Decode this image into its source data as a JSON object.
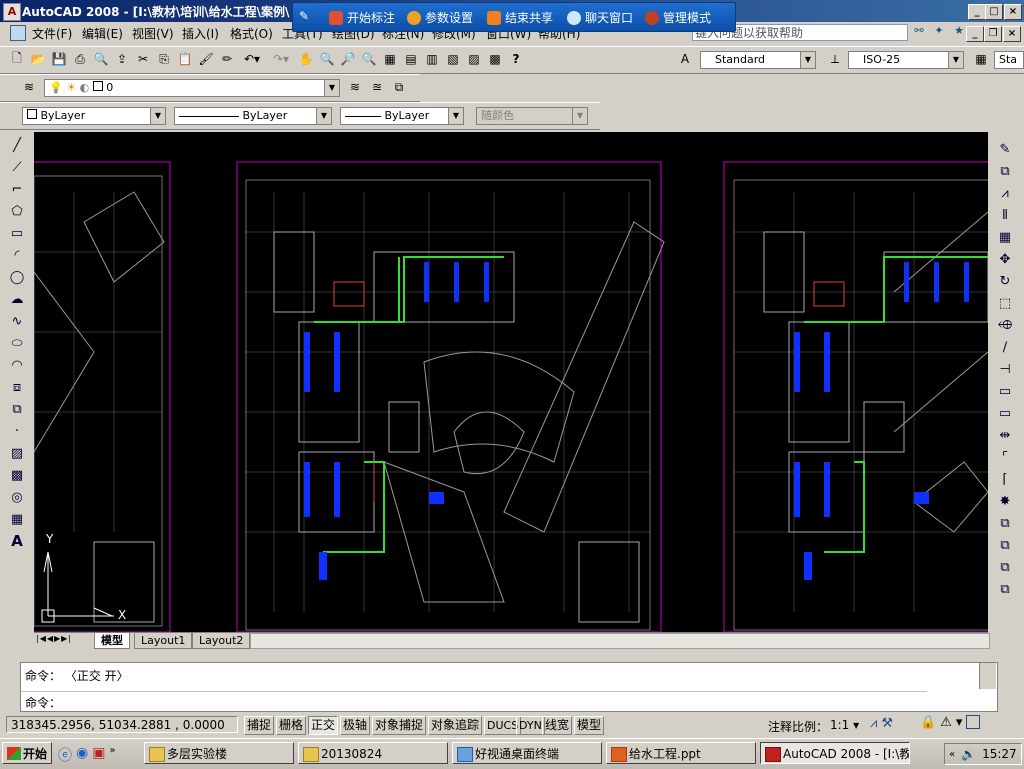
{
  "window": {
    "title": "AutoCAD 2008 - [I:\\教材\\培训\\给水工程\\案例\\",
    "buttons": [
      "_",
      "□",
      "×"
    ]
  },
  "sharebar": {
    "items": [
      {
        "label": "开始标注",
        "color": "#e05030"
      },
      {
        "label": "参数设置",
        "color": "#f0a020"
      },
      {
        "label": "结束共享",
        "color": "#f08020"
      },
      {
        "label": "聊天窗口",
        "color": "#d0e8ff"
      },
      {
        "label": "管理模式",
        "color": "#c04020"
      }
    ]
  },
  "menu": {
    "items": [
      "文件(F)",
      "编辑(E)",
      "视图(V)",
      "插入(I)",
      "格式(O)",
      "工具(T)",
      "绘图(D)",
      "标注(N)",
      "修改(M)",
      "窗口(W)",
      "帮助(H)"
    ],
    "help_placeholder": "键入问题以获取帮助"
  },
  "styles": {
    "text_style": "Standard",
    "dim_style": "ISO-25",
    "table_style": "Sta"
  },
  "layers": {
    "current": "0"
  },
  "properties": {
    "color": "ByLayer",
    "linetype": "ByLayer",
    "lineweight": "ByLayer",
    "plotstyle": "随颜色"
  },
  "tabs": [
    "模型",
    "Layout1",
    "Layout2"
  ],
  "ucs": {
    "y": "Y",
    "x": "X"
  },
  "command": {
    "history": "命令：  〈正交 开〉",
    "prompt": "命令："
  },
  "status": {
    "coords": "318345.2956, 51034.2881 , 0.0000",
    "toggles": [
      {
        "label": "捕捉",
        "on": false
      },
      {
        "label": "栅格",
        "on": false
      },
      {
        "label": "正交",
        "on": true
      },
      {
        "label": "极轴",
        "on": false
      },
      {
        "label": "对象捕捉",
        "on": false
      },
      {
        "label": "对象追踪",
        "on": false
      },
      {
        "label": "DUCS",
        "on": false
      },
      {
        "label": "DYN",
        "on": false
      },
      {
        "label": "线宽",
        "on": false
      },
      {
        "label": "模型",
        "on": false
      }
    ],
    "scale_label": "注释比例：",
    "scale_value": "1:1"
  },
  "taskbar": {
    "start": "开始",
    "tasks": [
      {
        "label": "多层实验楼",
        "active": false
      },
      {
        "label": "20130824",
        "active": false
      },
      {
        "label": "好视通桌面终端",
        "active": false
      },
      {
        "label": "给水工程.ppt",
        "active": false
      },
      {
        "label": "AutoCAD 2008 - [I:\\教...",
        "active": true
      }
    ],
    "clock": "15:27"
  }
}
